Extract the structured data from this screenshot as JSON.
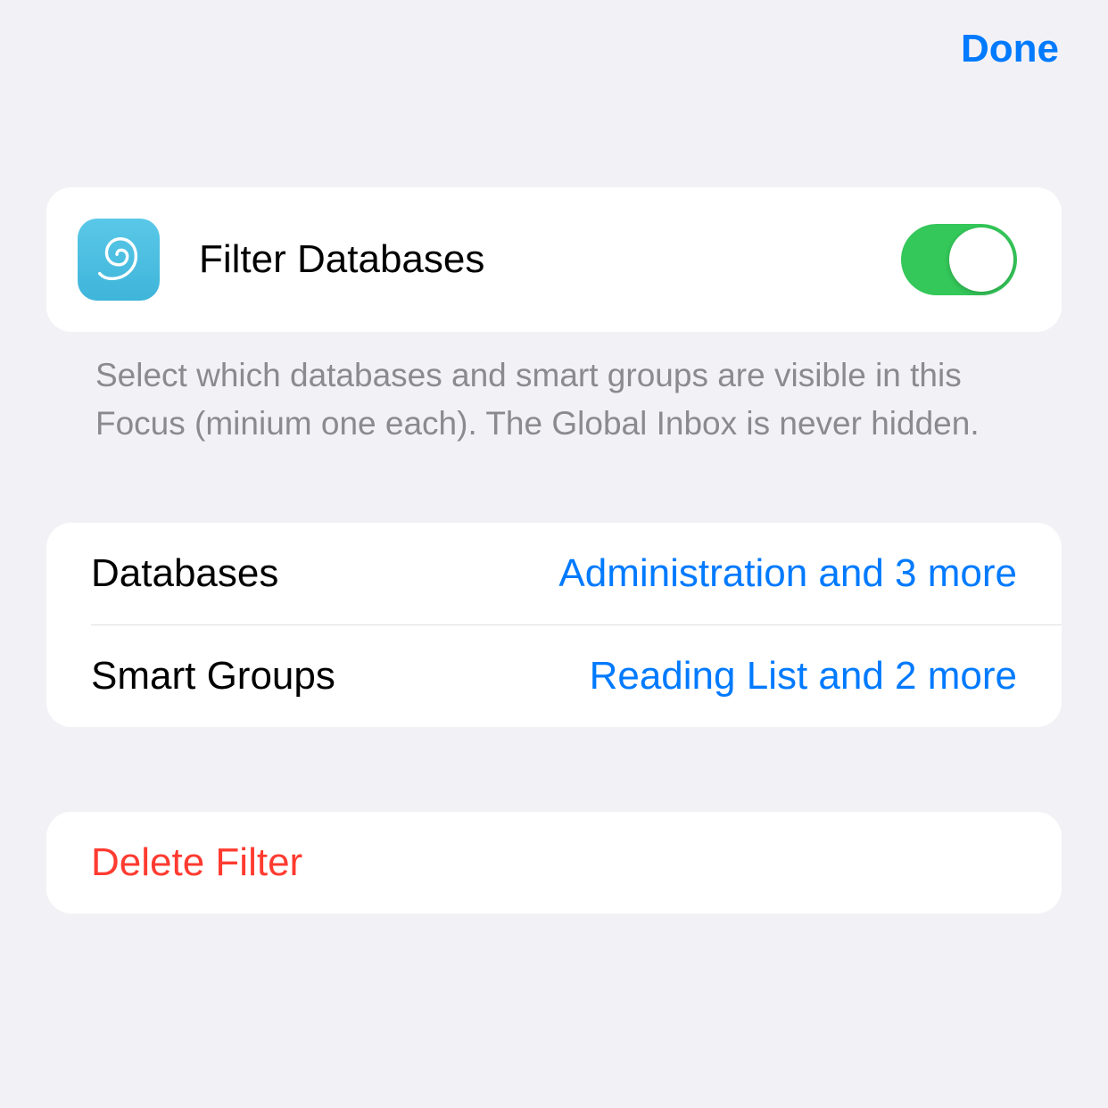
{
  "header": {
    "done": "Done"
  },
  "filter": {
    "title": "Filter Databases",
    "description": "Select which databases and smart groups are visible in this Focus (minium one each). The Global Inbox is never hidden."
  },
  "rows": {
    "databases": {
      "label": "Databases",
      "value": "Administration and 3 more"
    },
    "smartgroups": {
      "label": "Smart Groups",
      "value": "Reading List and 2 more"
    }
  },
  "delete": {
    "label": "Delete Filter"
  }
}
